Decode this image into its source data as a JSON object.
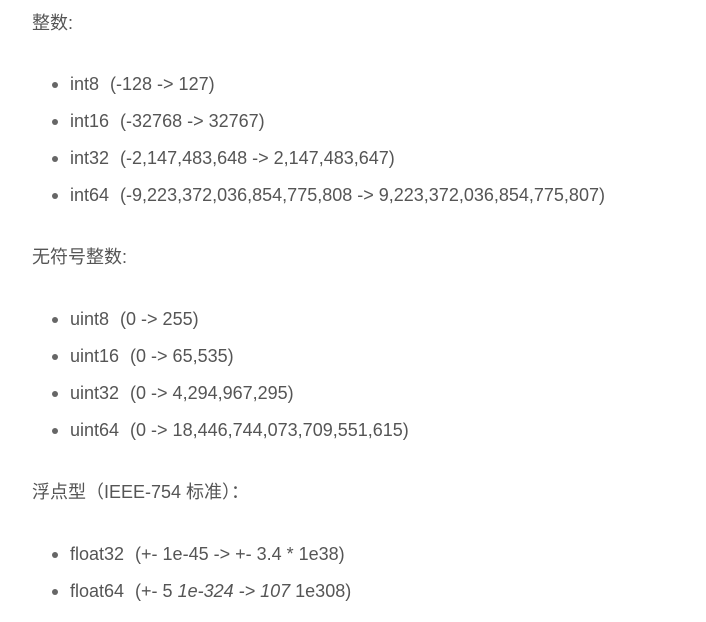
{
  "sections": [
    {
      "heading": "整数:",
      "items": [
        {
          "name": "int8",
          "range": "(-128 -> 127)"
        },
        {
          "name": "int16",
          "range": "(-32768 -> 32767)"
        },
        {
          "name": "int32",
          "range": "(-2,147,483,648 -> 2,147,483,647)"
        },
        {
          "name": "int64",
          "range": "(-9,223,372,036,854,775,808 -> 9,223,372,036,854,775,807)"
        }
      ]
    },
    {
      "heading": "无符号整数:",
      "items": [
        {
          "name": "uint8",
          "range": "(0 -> 255)"
        },
        {
          "name": "uint16",
          "range": "(0 -> 65,535)"
        },
        {
          "name": "uint32",
          "range": "(0 -> 4,294,967,295)"
        },
        {
          "name": "uint64",
          "range": "(0 -> 18,446,744,073,709,551,615)"
        }
      ]
    },
    {
      "heading": "浮点型（IEEE-754 标准）：",
      "items": [
        {
          "name": "float32",
          "range": "(+- 1e-45 -> +- 3.4 * 1e38)"
        },
        {
          "name": "float64",
          "range_part1": "(+- 5 ",
          "range_italic": "1e-324 -> 107",
          "range_part2": " 1e308)"
        }
      ]
    }
  ]
}
